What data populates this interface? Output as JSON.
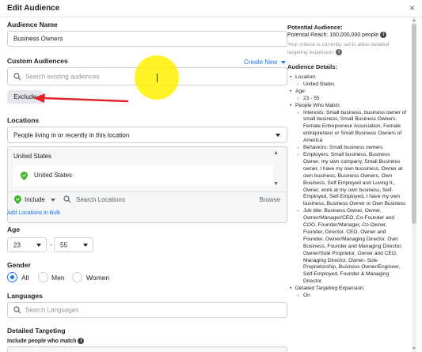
{
  "header": {
    "title": "Edit Audience",
    "close_icon": "×"
  },
  "audience_name": {
    "label": "Audience Name",
    "value": "Business Owners"
  },
  "custom_audiences": {
    "label": "Custom Audiences",
    "create_new": "Create New",
    "search_placeholder": "Search existing audiences",
    "exclude_label": "Exclude"
  },
  "locations": {
    "label": "Locations",
    "dropdown_value": "People living in or recently in this location",
    "country_header": "United States",
    "selected_location": "United States",
    "include_label": "Include",
    "search_placeholder": "Search Locations",
    "browse_label": "Browse",
    "add_bulk": "Add Locations in Bulk"
  },
  "age": {
    "label": "Age",
    "min": "23",
    "max": "55"
  },
  "gender": {
    "label": "Gender",
    "options": [
      "All",
      "Men",
      "Women"
    ],
    "selected": "All"
  },
  "languages": {
    "label": "Languages",
    "search_placeholder": "Search Languages"
  },
  "detailed_targeting": {
    "label": "Detailed Targeting",
    "sublabel": "Include people who match"
  },
  "potential_audience": {
    "title": "Potential Audience:",
    "reach": "Potential Reach: 160,000,000 people",
    "note": "Your criteria is currently set to allow detailed targeting expansion."
  },
  "audience_details": {
    "title": "Audience Details:",
    "location_label": "Location:",
    "location_value": "United States",
    "age_label": "Age:",
    "age_value": "23 - 55",
    "people_label": "People Who Match:",
    "interests": "Interests: Small business, business owner of small business, Small Business Owners, Female Entrepreneur Association, Female entrepreneur or Small Business Owners of America",
    "behaviors": "Behaviors: Small business owners",
    "employers": "Employers: Small business, Business Owner, my own company, Small Business owner, I have my own bussiness, Owner at own business, Business Owners, Own Business, Self Employed and Loving It., Owner, work at my own business, Self-Employed, Self-Employed, I have my own business, Business Owner or Own Business",
    "job_title": "Job title: Business Owner, Owner, Owner/Manager/CEO, Co-Founder and COO, Founder/Manager, Co Owner, Founder, Director, CEO, Owner and Founder, Owner/Managing Director, Own Business, Founder and Managing Director, Owner/Sole Proprietor, Owner and CEO, Managing Director, Owner- Sole Proprietorship, Business Owner/Engineer, Self-Employed, Founder & Managing Director",
    "expansion_label": "Detailed Targeting Expansion:",
    "expansion_value": "On"
  },
  "annotation": {
    "arrow_color": "#e0262b",
    "highlight_color": "#fff100"
  }
}
